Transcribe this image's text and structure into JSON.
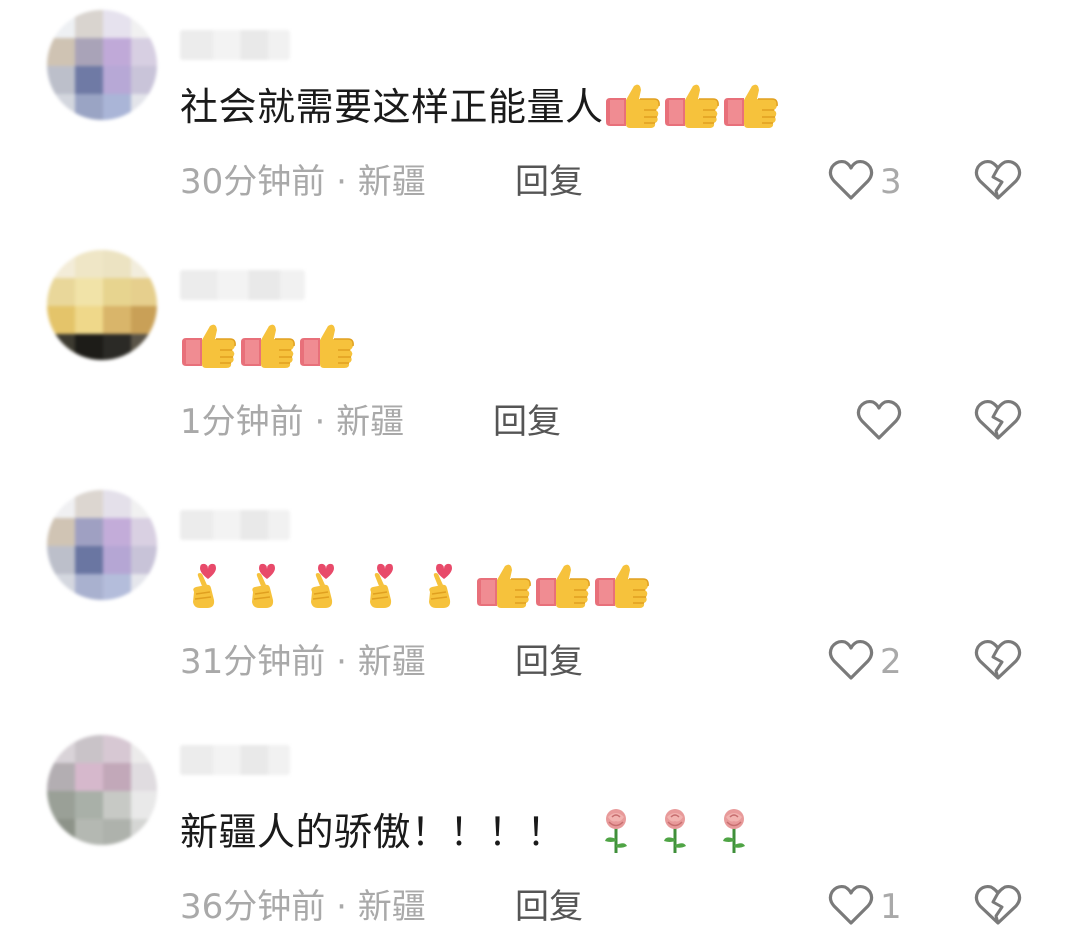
{
  "comments": [
    {
      "text": "社会就需要这样正能量人",
      "emojis": [
        "thumbs-up",
        "thumbs-up",
        "thumbs-up"
      ],
      "time": "30分钟前",
      "dot": "·",
      "location": "新疆",
      "reply_label": "回复",
      "likes": "3"
    },
    {
      "text": "",
      "emojis": [
        "thumbs-up",
        "thumbs-up",
        "thumbs-up"
      ],
      "time": "1分钟前",
      "dot": "·",
      "location": "新疆",
      "reply_label": "回复",
      "likes": ""
    },
    {
      "text": "",
      "emojis": [
        "heart-hands",
        "heart-hands",
        "heart-hands",
        "heart-hands",
        "heart-hands",
        "thumbs-up",
        "thumbs-up",
        "thumbs-up"
      ],
      "time": "31分钟前",
      "dot": "·",
      "location": "新疆",
      "reply_label": "回复",
      "likes": "2"
    },
    {
      "text": "新疆人的骄傲！！！！",
      "emojis": [
        "rose",
        "rose",
        "rose"
      ],
      "time": "36分钟前",
      "dot": "·",
      "location": "新疆",
      "reply_label": "回复",
      "likes": "1"
    }
  ],
  "icons": {
    "like": "heart-outline-icon",
    "dislike": "broken-heart-icon"
  },
  "colors": {
    "text": "#1a1a1a",
    "meta": "#a9a9a9",
    "reply": "#555555",
    "icon": "#7a7a7a"
  }
}
